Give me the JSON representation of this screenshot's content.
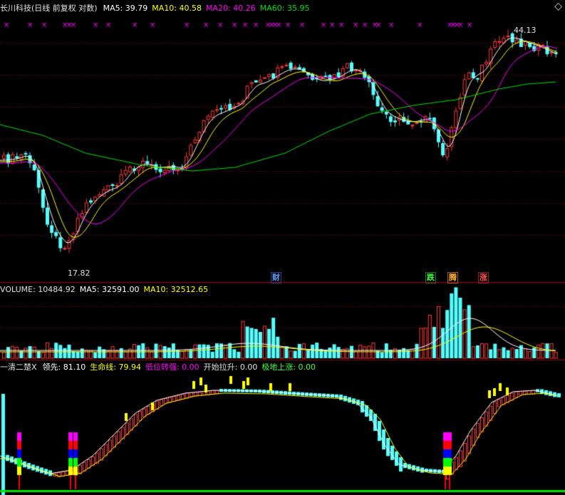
{
  "header": {
    "title": "长川科技(日线 前复权 对数)",
    "ma5": "MA5: 39.79",
    "ma10": "MA10: 40.58",
    "ma20": "MA20: 40.26",
    "ma60": "MA60: 35.95"
  },
  "price_chart": {
    "high_label": "44.13",
    "low_label": "17.82",
    "events": [
      "财",
      "跌",
      "腾",
      "涨"
    ]
  },
  "volume_header": {
    "volume": "VOLUME: 10484.92",
    "ma5": "MA5: 32591.00",
    "ma10": "MA10: 32512.65"
  },
  "indicator_header": {
    "name": "一清二楚X",
    "lead": "领先: 81.10",
    "life": "生命线: 79.94",
    "low_turn": "低位转强: 0.00",
    "start_pull": "开始拉升: 0.00",
    "ground_rise": "极地上涨: 0.00"
  },
  "colors": {
    "up": "#ff3b3b",
    "down": "#54ffff",
    "ma5": "#ffffff",
    "ma10": "#ffff00",
    "ma20": "#ff00ff",
    "ma60": "#00e000",
    "grid": "#7a0000",
    "indicator_lead": "#ffffff",
    "indicator_life": "#ffff00"
  }
}
